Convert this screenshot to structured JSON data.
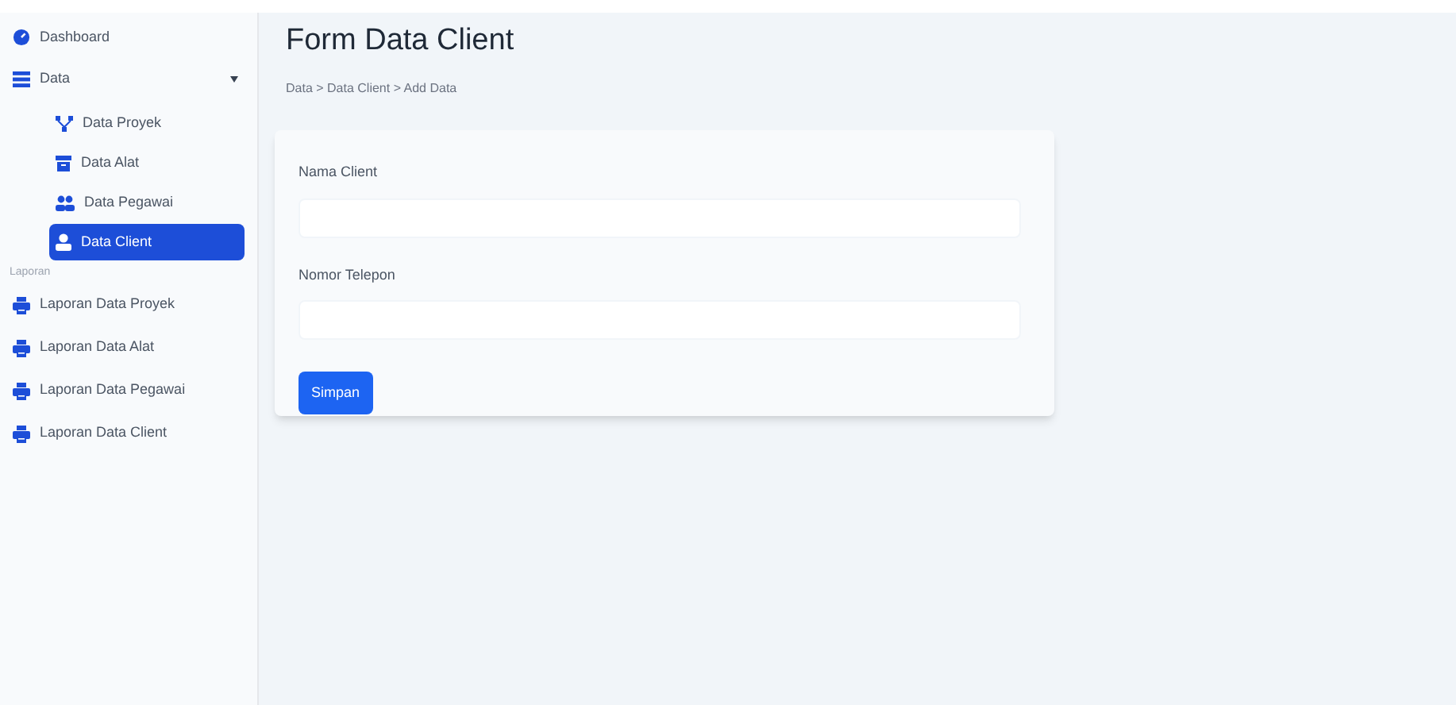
{
  "sidebar": {
    "items": [
      {
        "label": "Dashboard",
        "selected": false
      },
      {
        "label": "Data",
        "selected": false,
        "expanded": true,
        "children": [
          {
            "label": "Data Proyek",
            "selected": false
          },
          {
            "label": "Data Alat",
            "selected": false
          },
          {
            "label": "Data Pegawai",
            "selected": false
          },
          {
            "label": "Data Client",
            "selected": true
          }
        ]
      }
    ],
    "section": "Laporan",
    "reports": [
      {
        "label": "Laporan Data Proyek",
        "selected": false
      },
      {
        "label": "Laporan Data Alat",
        "selected": false
      },
      {
        "label": "Laporan Data Pegawai",
        "selected": false
      },
      {
        "label": "Laporan Data Client",
        "selected": false
      }
    ]
  },
  "page": {
    "title": "Form Data Client",
    "breadcrumb": "Data > Data Client > Add Data"
  },
  "form": {
    "fields": [
      {
        "label": "Nama Client"
      },
      {
        "label": "Nomor Telepon"
      }
    ],
    "submit": "Simpan"
  }
}
